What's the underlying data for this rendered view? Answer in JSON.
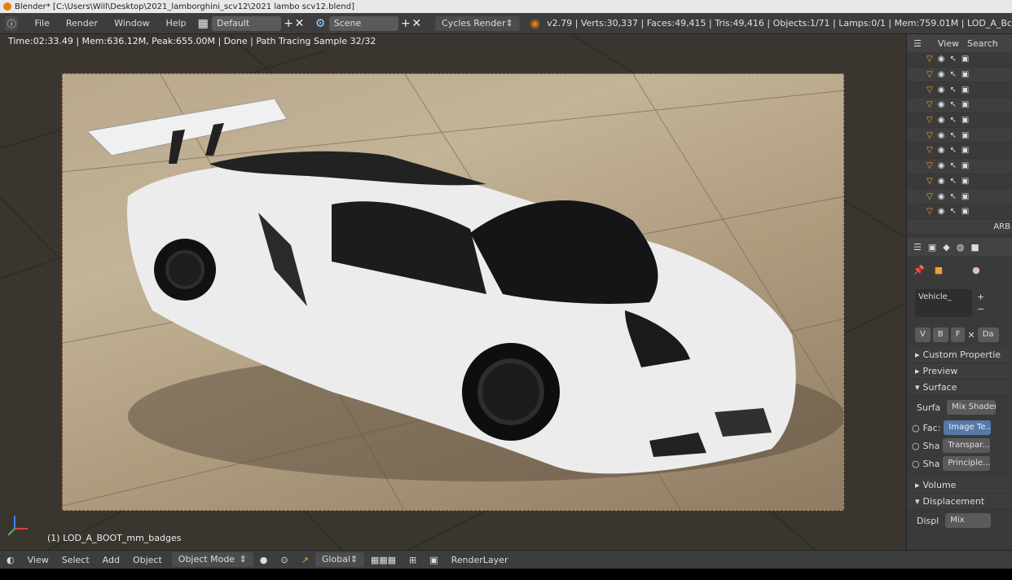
{
  "window": {
    "title": "Blender* [C:\\Users\\Will\\Desktop\\2021_lamborghini_scv12\\2021 lambo scv12.blend]"
  },
  "header": {
    "menus": [
      "File",
      "Render",
      "Window",
      "Help"
    ],
    "layout": "Default",
    "scene": "Scene",
    "engine": "Cycles Render",
    "stats": "v2.79 | Verts:30,337 | Faces:49,415 | Tris:49,416 | Objects:1/71 | Lamps:0/1 | Mem:759.01M | LOD_A_Bc"
  },
  "viewport": {
    "status": "Time:02:33.49 | Mem:636.12M, Peak:655.00M | Done | Path Tracing Sample 32/32",
    "object_name": "(1) LOD_A_BOOT_mm_badges"
  },
  "outliner": {
    "menus": [
      "View",
      "Search"
    ],
    "row_count": 12,
    "partial_text": "ARB"
  },
  "properties": {
    "material": "Vehicle_",
    "fields_row": [
      "V",
      "B",
      "F",
      "Da"
    ],
    "panels": {
      "custom": "Custom Propertie",
      "preview": "Preview",
      "surface": "Surface",
      "volume": "Volume",
      "displacement": "Displacement"
    },
    "surface_label": "Surfa",
    "surface_value": "Mix Shader",
    "fac_label": "Fac:",
    "fac_value": "Image Te...",
    "sha1_label": "Sha",
    "sha1_value": "Transpar...",
    "sha2_label": "Sha",
    "sha2_value": "Principle...",
    "displ_label": "Displ",
    "displ_value": "Mix"
  },
  "bottombar": {
    "menus": [
      "View",
      "Select",
      "Add",
      "Object"
    ],
    "mode": "Object Mode",
    "orientation": "Global",
    "render_layer": "RenderLayer"
  },
  "colors": {
    "accent_orange": "#e87d0d",
    "selected_blue": "#5679a6",
    "header_bg": "#3d3d3d"
  }
}
